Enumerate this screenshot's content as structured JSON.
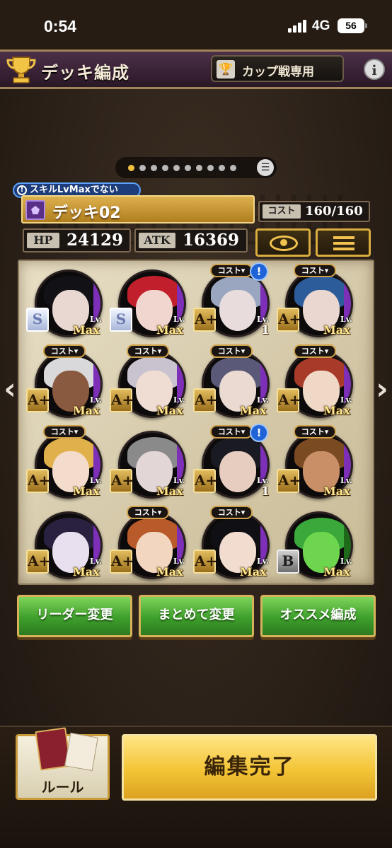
{
  "status_bar": {
    "time": "0:54",
    "network": "4G",
    "battery": "56"
  },
  "header": {
    "title": "デッキ編成",
    "badge_text": "カップ戦専用",
    "info_icon": "i"
  },
  "pagination": {
    "count": 10,
    "active_index": 0
  },
  "deck": {
    "warning": "スキルLvMaxでない",
    "warning_icon": "!",
    "name": "デッキ02",
    "cost_label": "コスト",
    "cost_value": "160/160",
    "hp_label": "HP",
    "hp_value": "24129",
    "atk_label": "ATK",
    "atk_value": "16369"
  },
  "cards": [
    {
      "rank": "S",
      "level": "Max",
      "cost_tag": "",
      "alert": false,
      "leader": true,
      "hair": "#111116",
      "skin": "#e9d8d2",
      "accent": "#7d2fb8"
    },
    {
      "rank": "S",
      "level": "Max",
      "cost_tag": "",
      "alert": false,
      "hair": "#c21f2c",
      "skin": "#f1d6cf",
      "accent": "#7d2fb8"
    },
    {
      "rank": "A+",
      "level": "1",
      "cost_tag": "コスト▾",
      "alert": true,
      "hair": "#9aa6c0",
      "skin": "#e8dcdc",
      "accent": "#7d2fb8"
    },
    {
      "rank": "A+",
      "level": "Max",
      "cost_tag": "コスト▾",
      "alert": false,
      "hair": "#2d5c9a",
      "skin": "#ead7cf",
      "accent": "#7d2fb8"
    },
    {
      "rank": "A+",
      "level": "Max",
      "cost_tag": "コスト▾",
      "alert": false,
      "hair": "#d9d9dc",
      "skin": "#8a5a40",
      "accent": "#7d2fb8"
    },
    {
      "rank": "A+",
      "level": "Max",
      "cost_tag": "コスト▾",
      "alert": false,
      "hair": "#c9c3d0",
      "skin": "#efdcd2",
      "accent": "#7d2fb8"
    },
    {
      "rank": "A+",
      "level": "Max",
      "cost_tag": "コスト▾",
      "alert": false,
      "hair": "#5a5a78",
      "skin": "#eadad2",
      "accent": "#7d2fb8"
    },
    {
      "rank": "A+",
      "level": "Max",
      "cost_tag": "コスト▾",
      "alert": false,
      "hair": "#a83a2a",
      "skin": "#f0d8c6",
      "accent": "#7d2fb8"
    },
    {
      "rank": "A+",
      "level": "Max",
      "cost_tag": "コスト▾",
      "alert": false,
      "hair": "#e0b04a",
      "skin": "#f3dccb",
      "accent": "#7d2fb8"
    },
    {
      "rank": "A+",
      "level": "Max",
      "cost_tag": "",
      "alert": false,
      "hair": "#8a8a8a",
      "skin": "#e3d6d6",
      "accent": "#7d2fb8"
    },
    {
      "rank": "A+",
      "level": "1",
      "cost_tag": "コスト▾",
      "alert": true,
      "hair": "#1a1a22",
      "skin": "#e6cdbf",
      "accent": "#7d2fb8"
    },
    {
      "rank": "A+",
      "level": "Max",
      "cost_tag": "コスト▾",
      "alert": false,
      "hair": "#7a4a22",
      "skin": "#c98f66",
      "accent": "#7d2fb8"
    },
    {
      "rank": "A+",
      "level": "Max",
      "cost_tag": "",
      "alert": false,
      "hair": "#2a2040",
      "skin": "#e8e0ee",
      "accent": "#7d2fb8"
    },
    {
      "rank": "A+",
      "level": "Max",
      "cost_tag": "コスト▾",
      "alert": false,
      "hair": "#b85a2a",
      "skin": "#f3d6c0",
      "accent": "#7d2fb8"
    },
    {
      "rank": "A+",
      "level": "Max",
      "cost_tag": "コスト▾",
      "alert": false,
      "hair": "#101014",
      "skin": "#f2dcd0",
      "accent": "#7d2fb8"
    },
    {
      "rank": "B",
      "level": "Max",
      "cost_tag": "",
      "alert": false,
      "hair": "#3aa83a",
      "skin": "#6ed64e",
      "accent": "#1f6a1a"
    }
  ],
  "lv_prefix": "Lv.",
  "actions": {
    "leader_change": "リーダー変更",
    "bulk_change": "まとめて変更",
    "recommended": "オススメ編成"
  },
  "footer": {
    "rules": "ルール",
    "complete": "編集完了"
  },
  "colors": {
    "header_purple": "#3a2236",
    "gold": "#d9ad3e",
    "green": "#3e9f2c",
    "yellow": "#f3c436"
  }
}
